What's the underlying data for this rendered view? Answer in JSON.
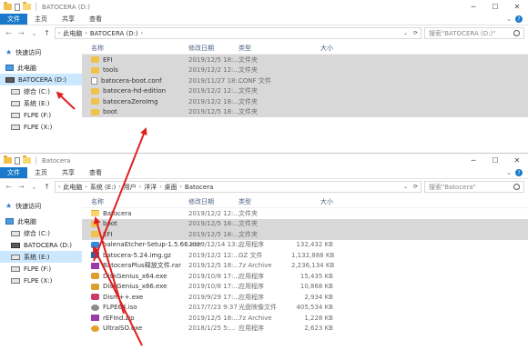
{
  "window_top": {
    "title": "BATOCERA (D:)",
    "ribbon_tabs": [
      "文件",
      "主页",
      "共享",
      "查看"
    ],
    "address": {
      "segments": [
        "此电脑",
        "BATOCERA (D:)"
      ]
    },
    "search_placeholder": "搜索\"BATOCERA (D:)\"",
    "sidebar": [
      {
        "label": "快速访问",
        "icon": "star-icon"
      },
      {
        "label": "此电脑",
        "icon": "computer-icon"
      },
      {
        "label": "BATOCERA (D:)",
        "icon": "drive-icon",
        "selected": true
      },
      {
        "label": "综合 (C:)",
        "icon": "drive-icon"
      },
      {
        "label": "系统 (E:)",
        "icon": "drive-icon"
      },
      {
        "label": "FLPE (F:)",
        "icon": "drive-icon"
      },
      {
        "label": "FLPE (X:)",
        "icon": "drive-icon"
      }
    ],
    "columns": {
      "name": "名称",
      "date": "修改日期",
      "type": "类型",
      "size": "大小"
    },
    "files": [
      {
        "name": "EFI",
        "date": "2019/12/5 18:...",
        "type": "文件夹",
        "size": "",
        "icon": "folder"
      },
      {
        "name": "tools",
        "date": "2019/12/2 12:...",
        "type": "文件夹",
        "size": "",
        "icon": "folder"
      },
      {
        "name": "batocera-boot.conf",
        "date": "2019/11/27 18:...",
        "type": "CONF 文件",
        "size": "",
        "icon": "file"
      },
      {
        "name": "batocera-hd-edition",
        "date": "2019/12/2 12:...",
        "type": "文件夹",
        "size": "",
        "icon": "folder"
      },
      {
        "name": "batoceraZeroImg",
        "date": "2019/12/2 18:...",
        "type": "文件夹",
        "size": "",
        "icon": "folder"
      },
      {
        "name": "boot",
        "date": "2019/12/5 18:...",
        "type": "文件夹",
        "size": "",
        "icon": "folder"
      }
    ]
  },
  "window_bottom": {
    "title": "Batocera",
    "ribbon_tabs": [
      "文件",
      "主页",
      "共享",
      "查看"
    ],
    "address": {
      "segments": [
        "此电脑",
        "系统 (E:)",
        "用户",
        "洋洋",
        "桌面",
        "Batocera"
      ]
    },
    "search_placeholder": "搜索\"Batocera\"",
    "sidebar": [
      {
        "label": "快速访问",
        "icon": "star-icon"
      },
      {
        "label": "此电脑",
        "icon": "computer-icon"
      },
      {
        "label": "综合 (C:)",
        "icon": "drive-icon"
      },
      {
        "label": "BATOCERA (D:)",
        "icon": "drive-icon"
      },
      {
        "label": "系统 (E:)",
        "icon": "drive-icon",
        "selected": true
      },
      {
        "label": "FLPE (F:)",
        "icon": "drive-icon"
      },
      {
        "label": "FLPE (X:)",
        "icon": "drive-icon"
      }
    ],
    "columns": {
      "name": "名称",
      "date": "修改日期",
      "type": "类型",
      "size": "大小"
    },
    "files": [
      {
        "name": "Batocera",
        "date": "2019/12/2 12:...",
        "type": "文件夹",
        "size": "",
        "icon": "folder"
      },
      {
        "name": "boot",
        "date": "2019/12/5 18:...",
        "type": "文件夹",
        "size": "",
        "icon": "folder",
        "selected": true
      },
      {
        "name": "EFI",
        "date": "2019/12/5 18:...",
        "type": "文件夹",
        "size": "",
        "icon": "folder",
        "selected": true
      },
      {
        "name": "balenaEtcher-Setup-1.5.66.exe",
        "date": "2019/12/14 13:...",
        "type": "应用程序",
        "size": "132,432 KB",
        "icon": "exe"
      },
      {
        "name": "batocera-5.24.img.gz",
        "date": "2019/12/2 12:...",
        "type": "GZ 文件",
        "size": "1,132,888 KB",
        "icon": "gz"
      },
      {
        "name": "BatoceraPlus释放文件.rar",
        "date": "2019/12/5 18:...",
        "type": "7z Archive",
        "size": "2,236,134 KB",
        "icon": "rar"
      },
      {
        "name": "DiskGenius_x64.exe",
        "date": "2019/10/8 17:...",
        "type": "应用程序",
        "size": "15,435 KB",
        "icon": "exe-dg"
      },
      {
        "name": "DiskGenius_x86.exe",
        "date": "2019/10/8 17:...",
        "type": "应用程序",
        "size": "10,868 KB",
        "icon": "exe-dg"
      },
      {
        "name": "Dism++.exe",
        "date": "2019/9/29 17:...",
        "type": "应用程序",
        "size": "2,934 KB",
        "icon": "exe-dm"
      },
      {
        "name": "FLPE64.iso",
        "date": "2017/7/23 9:37",
        "type": "光盘映像文件",
        "size": "405,534 KB",
        "icon": "iso"
      },
      {
        "name": "rEFInd.zip",
        "date": "2019/12/5 18:...",
        "type": "7z Archive",
        "size": "1,228 KB",
        "icon": "rar"
      },
      {
        "name": "UltraISO.exe",
        "date": "2018/1/25 5:...",
        "type": "应用程序",
        "size": "2,623 KB",
        "icon": "exe-uiso"
      }
    ]
  },
  "annotation_color": "#e02020"
}
